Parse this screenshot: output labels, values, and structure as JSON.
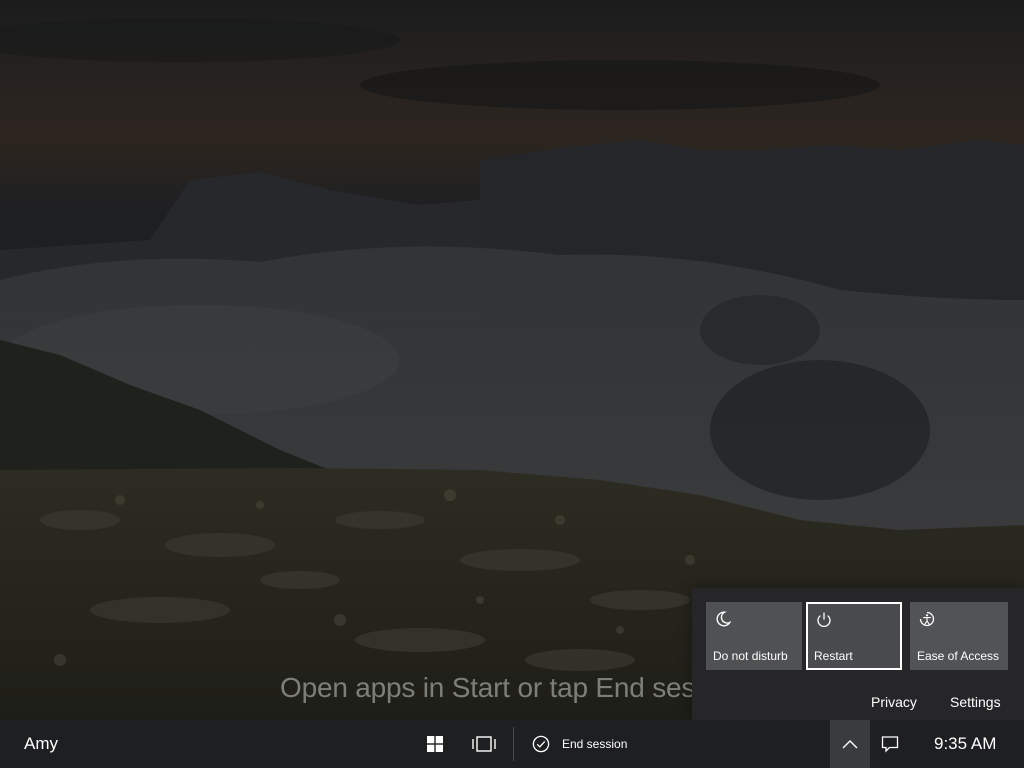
{
  "hint_text": "Open apps in Start or tap End ses",
  "quick_actions": {
    "tiles": [
      {
        "label": "Do not disturb",
        "icon": "moon-icon"
      },
      {
        "label": "Restart",
        "icon": "power-icon"
      },
      {
        "label": "Ease of Access",
        "icon": "ease-of-access-icon"
      }
    ],
    "privacy_label": "Privacy",
    "settings_label": "Settings"
  },
  "taskbar": {
    "user_name": "Amy",
    "end_session_label": "End session",
    "time": "9:35 AM",
    "icons": [
      "windows-start-icon",
      "task-view-icon",
      "check-circle-icon",
      "chevron-up-icon",
      "notification-icon"
    ]
  },
  "colors": {
    "taskbar_bg": "#1e1f21",
    "flyout_bg": "#26272a",
    "tile_bg": "#505153",
    "selected_border": "#ffffff"
  }
}
